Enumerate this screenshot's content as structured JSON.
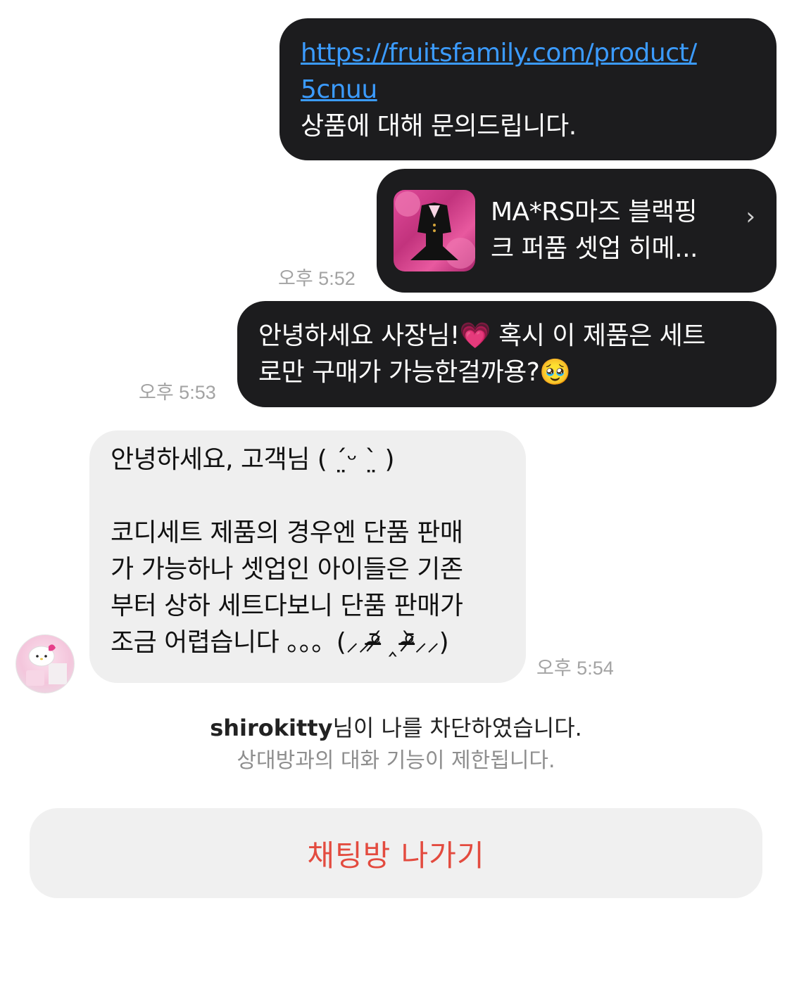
{
  "messages": {
    "m1": {
      "link_line1": "https://fruitsfamily.com/product/",
      "link_line2": "5cnuu",
      "text": "상품에 대해 문의드립니다."
    },
    "product_card": {
      "title_line1": "MA*RS마즈 블랙핑",
      "title_line2": "크 퍼품 셋업 히메...",
      "time": "오후 5:52",
      "thumbnail_icon": "product-thumbnail"
    },
    "m3": {
      "line1": "안녕하세요 사장님!💗 혹시 이 제품은 세트",
      "line2": "로만 구매가 가능한걸까용?🥹",
      "time": "오후 5:53"
    },
    "reply": {
      "line1": "안녕하세요, 고객님 ( ˊ̤ᵕ ˋ̤ )",
      "line2": "코디세트 제품의 경우엔 단품 판매",
      "line3": "가 가능하나 셋업인 아이들은 기존",
      "line4": "부터 상하 세트다보니 단품 판매가",
      "line5": "조금 어렵습니다 。。。(⸝⸝ᵒ̴̶̷᷄ ‸ ᵒ̴̶̷᷅⸝⸝)",
      "time": "오후 5:54"
    }
  },
  "block_notice": {
    "username": "shirokitty",
    "suffix": "님이 나를 차단하였습니다.",
    "subtitle": "상대방과의 대화 기능이 제한됩니다."
  },
  "actions": {
    "leave_label": "채팅방 나가기"
  },
  "colors": {
    "outgoing_bubble": "#1c1c1e",
    "incoming_bubble": "#efefef",
    "link": "#3b9bff",
    "danger": "#e34b3f"
  }
}
